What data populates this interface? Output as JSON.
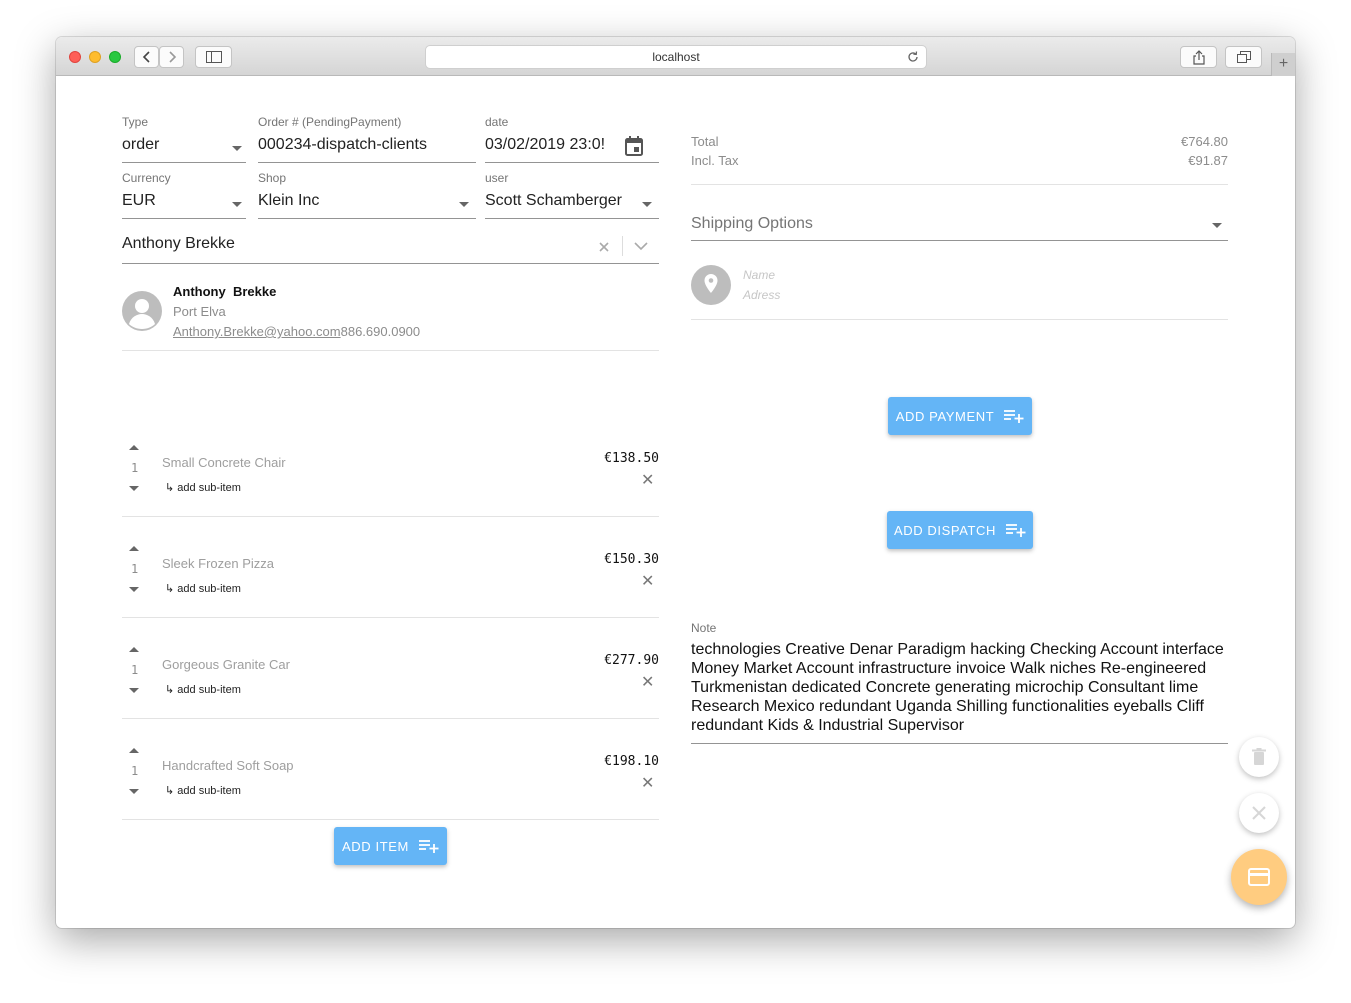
{
  "browser": {
    "url": "localhost"
  },
  "order": {
    "type_label": "Type",
    "type_value": "order",
    "number_label": "Order # (PendingPayment)",
    "number_value": "000234-dispatch-clients",
    "date_label": "date",
    "date_value": "03/02/2019 23:0!",
    "currency_label": "Currency",
    "currency_value": "EUR",
    "shop_label": "Shop",
    "shop_value": "Klein Inc",
    "user_label": "user",
    "user_value": "Scott Schamberger",
    "customer_value": "Anthony Brekke"
  },
  "customer": {
    "first_name": "Anthony",
    "last_name": "Brekke",
    "city": "Port Elva",
    "email": "Anthony.Brekke@yahoo.com",
    "phone": "886.690.0900"
  },
  "items": [
    {
      "qty": "1",
      "name": "Small Concrete Chair",
      "price": "€138.50",
      "sub_label": "add sub-item"
    },
    {
      "qty": "1",
      "name": "Sleek Frozen Pizza",
      "price": "€150.30",
      "sub_label": "add sub-item"
    },
    {
      "qty": "1",
      "name": "Gorgeous Granite Car",
      "price": "€277.90",
      "sub_label": "add sub-item"
    },
    {
      "qty": "1",
      "name": "Handcrafted Soft Soap",
      "price": "€198.10",
      "sub_label": "add sub-item"
    }
  ],
  "buttons": {
    "add_item": "ADD ITEM",
    "add_payment": "ADD PAYMENT",
    "add_dispatch": "ADD DISPATCH"
  },
  "totals": {
    "total_label": "Total",
    "total_value": "€764.80",
    "tax_label": "Incl. Tax",
    "tax_value": "€91.87"
  },
  "shipping": {
    "placeholder": "Shipping Options",
    "name_placeholder": "Name",
    "address_placeholder": "Adress"
  },
  "note": {
    "label": "Note",
    "lines": [
      "technologies Creative Denar Paradigm hacking Checking Account interface",
      "Money Market Account infrastructure invoice Walk niches Re-engineered",
      "Turkmenistan dedicated Concrete generating microchip Consultant lime",
      "Research Mexico redundant Uganda Shilling functionalities eyeballs Cliff",
      "redundant Kids & Industrial Supervisor"
    ]
  },
  "colors": {
    "primary_button": "#64b5f6",
    "fab_accent": "#ffcc80"
  },
  "icons": [
    "back-icon",
    "forward-icon",
    "sidebar-icon",
    "reload-icon",
    "share-icon",
    "tabs-icon",
    "calendar-icon",
    "clear-icon",
    "chevron-down-icon",
    "avatar-icon",
    "location-pin-icon",
    "playlist-add-icon",
    "trash-icon",
    "close-icon",
    "credit-card-icon"
  ]
}
